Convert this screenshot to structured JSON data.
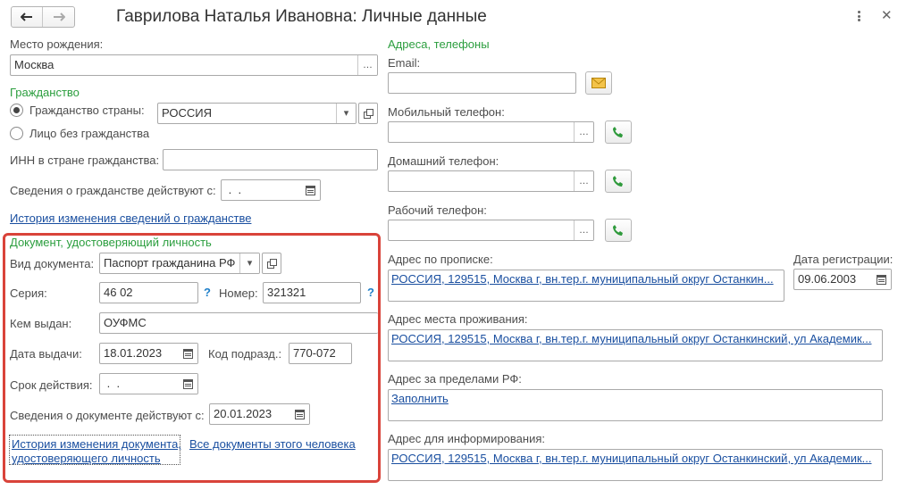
{
  "window": {
    "title": "Гаврилова Наталья Ивановна: Личные данные"
  },
  "left": {
    "birthplace_label": "Место рождения:",
    "birthplace_value": "Москва",
    "citizenship_section": "Гражданство",
    "citizenship_country_label": "Гражданство страны:",
    "citizenship_country_value": "РОССИЯ",
    "stateless_label": "Лицо без гражданства",
    "inn_label": "ИНН в стране гражданства:",
    "inn_value": "",
    "citizenship_valid_label": "Сведения о гражданстве действуют с:",
    "citizenship_valid_value": " .  .",
    "citizenship_history_link": "История изменения сведений о гражданстве"
  },
  "document": {
    "section": "Документ, удостоверяющий личность",
    "type_label": "Вид документа:",
    "type_value": "Паспорт гражданина РФ",
    "series_label": "Серия:",
    "series_value": "46 02",
    "number_label": "Номер:",
    "number_value": "321321",
    "issued_by_label": "Кем выдан:",
    "issued_by_value": "ОУФМС",
    "issue_date_label": "Дата выдачи:",
    "issue_date_value": "18.01.2023",
    "dept_code_label": "Код подразд.:",
    "dept_code_value": "770-072",
    "expiry_label": "Срок действия:",
    "expiry_value": " .  .",
    "valid_from_label": "Сведения о документе действуют с:",
    "valid_from_value": "20.01.2023",
    "history_link_line1": "История изменения документа,",
    "history_link_line2": "удостоверяющего личность",
    "all_docs_link": "Все документы этого человека",
    "question_mark": "?"
  },
  "right": {
    "section": "Адреса, телефоны",
    "email_label": "Email:",
    "email_value": "",
    "mobile_label": "Мобильный телефон:",
    "home_label": "Домашний телефон:",
    "work_label": "Рабочий телефон:",
    "reg_address_label": "Адрес по прописке:",
    "reg_address_value": "РОССИЯ, 129515, Москва г, вн.тер.г. муниципальный округ Останкин...",
    "reg_date_label": "Дата регистрации:",
    "reg_date_value": "09.06.2003",
    "residence_label": "Адрес места проживания:",
    "residence_value": "РОССИЯ, 129515, Москва г, вн.тер.г. муниципальный округ Останкинский, ул Академик...",
    "abroad_label": "Адрес за пределами РФ:",
    "abroad_link": "Заполнить",
    "info_label": "Адрес для информирования:",
    "info_value": "РОССИЯ, 129515, Москва г, вн.тер.г. муниципальный округ Останкинский, ул Академик..."
  },
  "colors": {
    "section_green": "#2b9e3e",
    "link_blue": "#1a4fa0",
    "highlight_red": "#d9433a",
    "phone_green": "#2f9a3c"
  }
}
